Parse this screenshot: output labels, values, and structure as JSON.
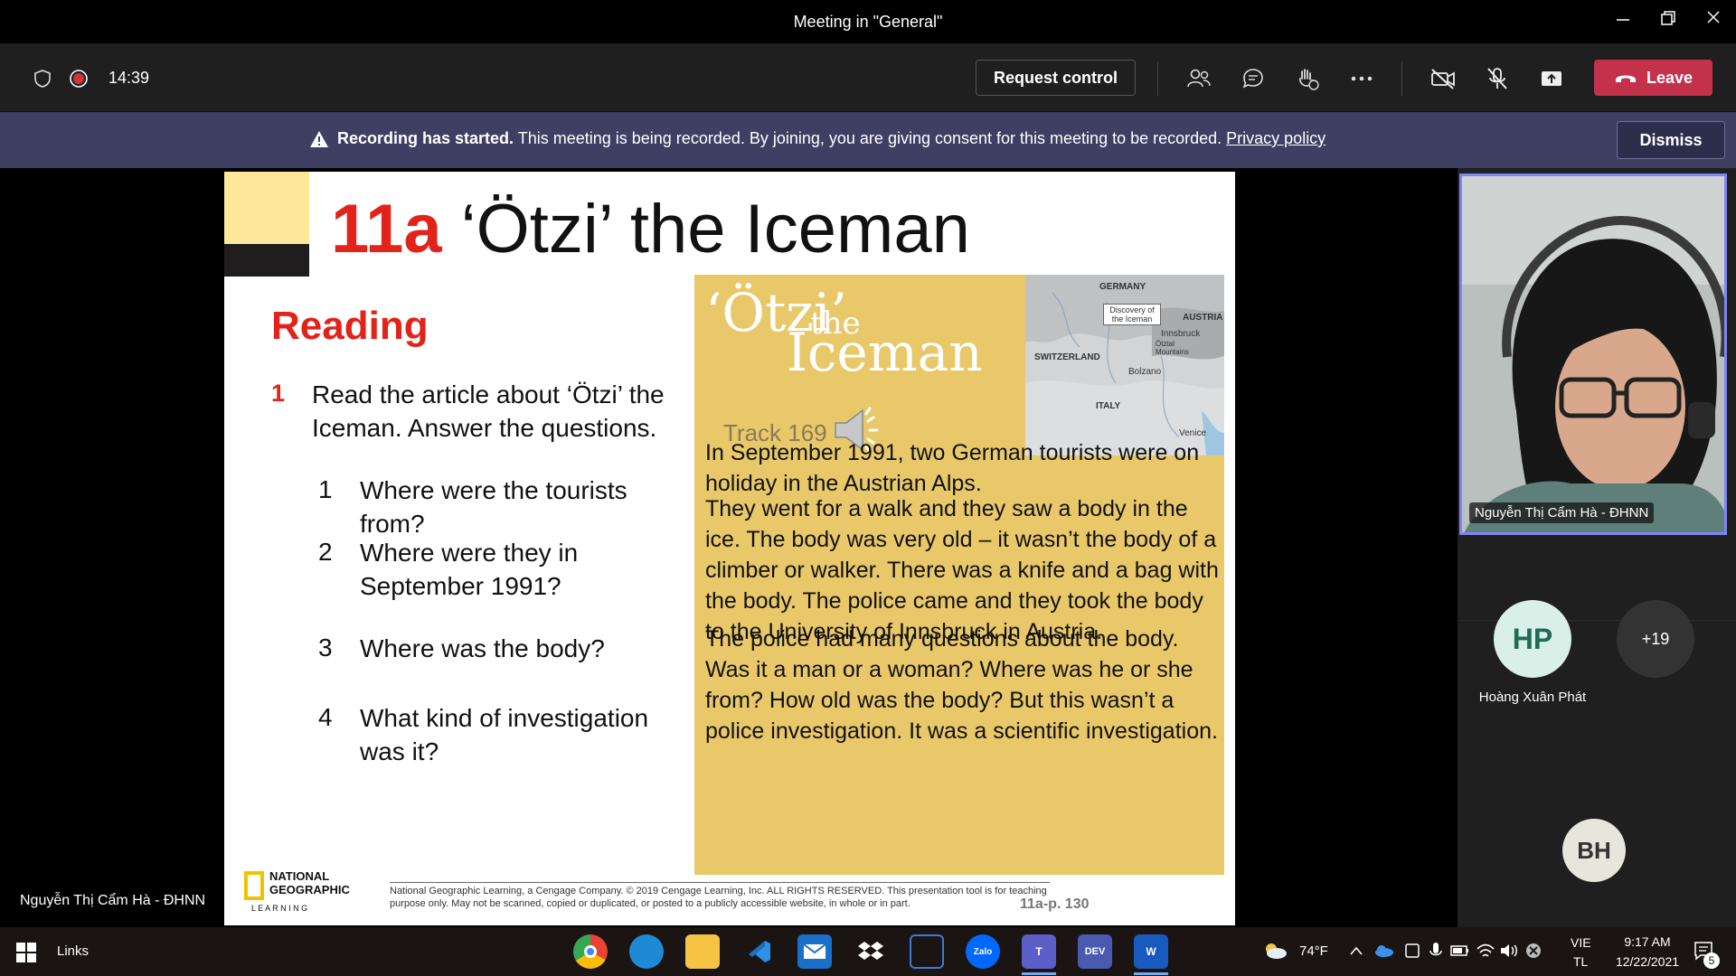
{
  "window": {
    "title": "Meeting in \"General\""
  },
  "meeting": {
    "timer": "14:39",
    "request_control": "Request control",
    "leave": "Leave"
  },
  "banner": {
    "bold": "Recording has started.",
    "message": " This meeting is being recorded. By joining, you are giving consent for this meeting to be recorded. ",
    "link": "Privacy policy",
    "dismiss": "Dismiss"
  },
  "slide": {
    "code": "11a",
    "title": " ‘Ötzi’ the Iceman",
    "section": "Reading",
    "task_number": "1",
    "task_text": "Read the article about ‘Ötzi’ the Iceman. Answer the questions.",
    "questions": [
      {
        "num": "1",
        "text": "Where were the tourists from?"
      },
      {
        "num": "2",
        "text": "Where were they in September 1991?"
      },
      {
        "num": "3",
        "text": "Where was the body?"
      },
      {
        "num": "4",
        "text": "What kind of investigation was it?"
      }
    ],
    "panel_title_1": "‘Ötzi’",
    "panel_title_2": "the",
    "panel_title_3": "Iceman",
    "track": "Track 169",
    "map_labels": {
      "germany": "GERMANY",
      "austria": "AUSTRIA",
      "discovery": "Discovery of the Iceman",
      "innsbruck": "Innsbruck",
      "otztal": "Ötztal Mountains",
      "switzerland": "SWITZERLAND",
      "bolzano": "Bolzano",
      "italy": "ITALY",
      "venice": "Venice"
    },
    "paragraphs": [
      "In September 1991, two German tourists were on holiday in the Austrian Alps.",
      "They went for a walk and they saw a body in the ice. The body was very old – it wasn’t the body of a climber or walker. There was a knife and a bag with the body. The police came and they took the body to the University of Innsbruck in Austria.",
      "The police had many questions about the body. Was it a man or a woman? Where was he or she from? How old was the body? But this wasn’t a police investigation. It was a scientific investigation."
    ],
    "logo_line1": "NATIONAL",
    "logo_line2": "GEOGRAPHIC",
    "logo_line3": "L E A R N I N G",
    "footer": "National Geographic Learning, a Cengage Company. © 2019 Cengage Learning, Inc. ALL RIGHTS RESERVED. This presentation tool is for teaching purpose only. May not be scanned, copied or duplicated, or posted to a publicly accessible website, in whole or in part.",
    "page_ref": "11a-p. 130"
  },
  "stage_presenter": "Nguyễn Thị Cẩm Hà - ĐHNN",
  "participants": {
    "self_name": "Nguyễn Thị Cẩm Hà - ĐHNN",
    "hp_initials": "HP",
    "hp_name": "Hoàng Xuân Phát",
    "more": "+19",
    "bh_initials": "BH"
  },
  "taskbar": {
    "links": "Links",
    "weather": "74°F",
    "lang1": "VIE",
    "lang2": "TL",
    "time": "9:17 AM",
    "date": "12/22/2021",
    "notif_count": "5"
  },
  "colors": {
    "accent_red": "#e2231a",
    "leave_red": "#c4314b",
    "banner_bg": "#3e3f63",
    "panel_gold": "#e9c86a",
    "self_border": "#7f85f5"
  }
}
